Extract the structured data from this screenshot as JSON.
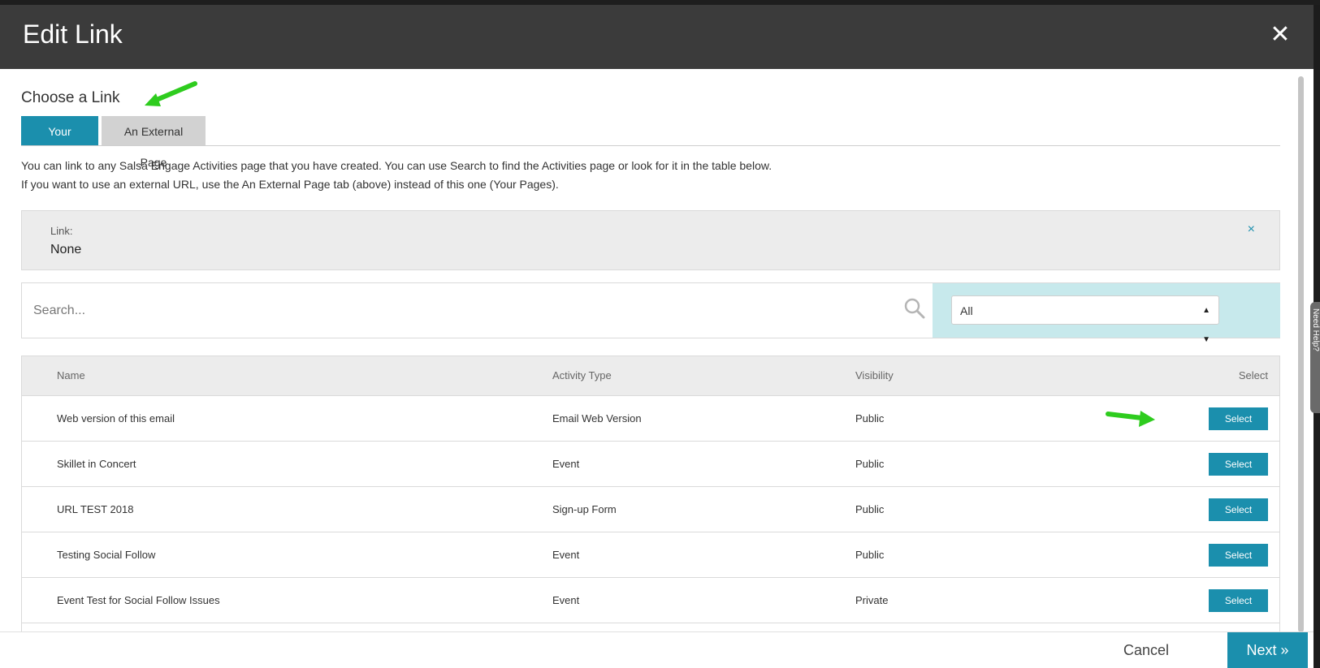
{
  "modal": {
    "title": "Edit Link",
    "close_icon": "close-icon"
  },
  "chooser": {
    "title": "Choose a Link",
    "tabs": [
      {
        "label": "Your Pages",
        "active": true
      },
      {
        "label": "An External Page",
        "active": false
      }
    ],
    "description": [
      "You can link to any Salsa Engage Activities page that you have created. You can use Search to find the Activities page or look for it in the table below.",
      "If you want to use an external URL, use the An External Page tab (above) instead of this one (Your Pages)."
    ]
  },
  "link": {
    "label": "Link:",
    "value": "None",
    "clear_icon": "×"
  },
  "search": {
    "placeholder": "Search...",
    "icon": "search-icon",
    "filter_value": "All"
  },
  "table": {
    "columns": [
      "Name",
      "Activity Type",
      "Visibility",
      "Select"
    ],
    "rows": [
      {
        "name": "Web version of this email",
        "type": "Email Web Version",
        "visibility": "Public",
        "action": "Select"
      },
      {
        "name": "Skillet in Concert",
        "type": "Event",
        "visibility": "Public",
        "action": "Select"
      },
      {
        "name": "URL TEST 2018",
        "type": "Sign-up Form",
        "visibility": "Public",
        "action": "Select"
      },
      {
        "name": "Testing Social Follow",
        "type": "Event",
        "visibility": "Public",
        "action": "Select"
      },
      {
        "name": "Event Test for Social Follow Issues",
        "type": "Event",
        "visibility": "Private",
        "action": "Select"
      }
    ]
  },
  "footer": {
    "cancel_label": "Cancel",
    "next_label": "Next »"
  },
  "side_tab": {
    "label": "Need Help?"
  },
  "colors": {
    "accent": "#1b8fad",
    "header_bg": "#3b3b3b",
    "filter_bg": "#c7e9ec",
    "annotation_arrow": "#2ecc1e"
  }
}
